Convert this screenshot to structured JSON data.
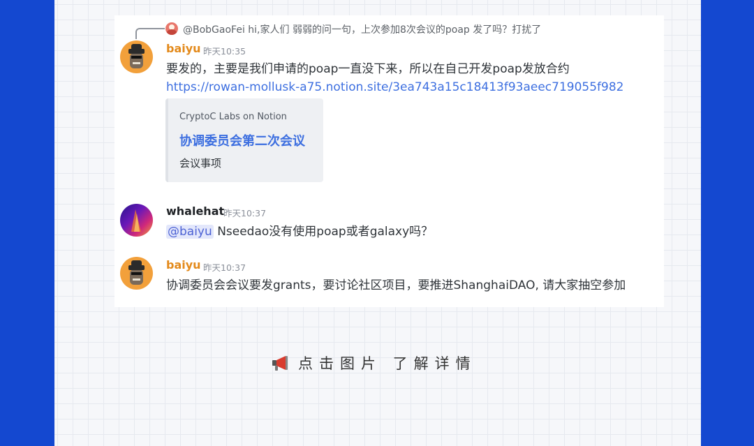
{
  "colors": {
    "outer_background": "#1448d0",
    "page_background": "#f6f7fa",
    "username_baiyu": "#e38a1b",
    "username_whalehat": "#1f2226",
    "link": "#3d6fe0",
    "mention_bg": "#e3e7fb",
    "mention_text": "#4d62d4"
  },
  "reply": {
    "author": "@BobGaoFei",
    "text": "hi,家人们 弱弱的问一句，上次参加8次会议的poap 发了吗？打扰了"
  },
  "messages": [
    {
      "username": "baiyu",
      "timestamp": "昨天10:35",
      "text": "要发的，主要是我们申请的poap一直没下来，所以在自己开发poap发放合约",
      "link": "https://rowan-mollusk-a75.notion.site/3ea743a15c18413f93aeec719055f982",
      "embed": {
        "provider": "CryptoC Labs on Notion",
        "title": "协调委员会第二次会议",
        "description": "会议事项"
      }
    },
    {
      "username": "whalehat",
      "timestamp": "昨天10:37",
      "mention": "@baiyu",
      "text": "Nseedao没有使用poap或者galaxy吗？"
    },
    {
      "username": "baiyu",
      "timestamp": "昨天10:37",
      "text": "协调委员会会议要发grants，要讨论社区项目，要推进ShanghaiDAO, 请大家抽空参加"
    }
  ],
  "cta": {
    "icon": "megaphone-icon",
    "text": "点击图片 了解详情"
  }
}
